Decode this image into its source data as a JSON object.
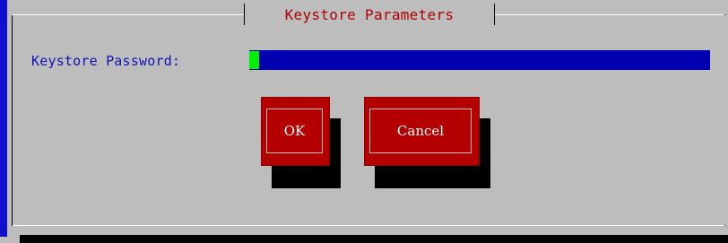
{
  "dialog": {
    "title": "Keystore Parameters",
    "field_label": "Keystore Password:",
    "field_value": ""
  },
  "buttons": {
    "ok_label": "OK",
    "cancel_label": "Cancel"
  },
  "colors": {
    "background": "#bdbdbd",
    "title_text": "#b00000",
    "label_text": "#1212b6",
    "input_background": "#0000b0",
    "cursor": "#00f000",
    "button_background": "#b40000",
    "button_text": "#ffffff",
    "shadow": "#000000"
  }
}
